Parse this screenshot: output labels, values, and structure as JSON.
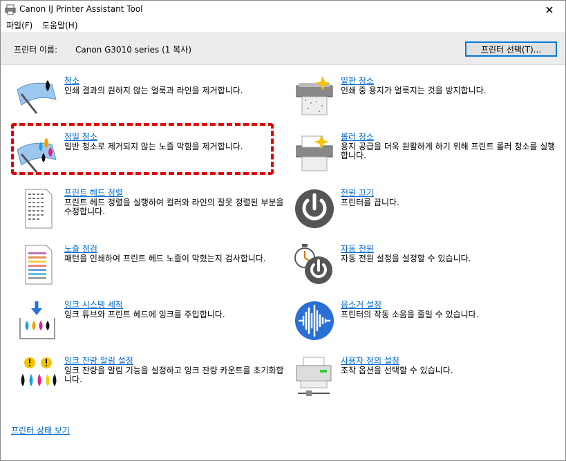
{
  "window": {
    "title": "Canon IJ Printer Assistant Tool",
    "close_label": "✕"
  },
  "menu": {
    "file": "파일(F)",
    "help": "도움말(H)"
  },
  "printer": {
    "label": "프린터 이름:",
    "name": "Canon G3010 series (1 복사)",
    "select_button": "프린터 선택(T)..."
  },
  "items": {
    "cleaning": {
      "title": "청소",
      "desc": "인쇄 결과의 원하지 않는 얼룩과 라인을 제거합니다."
    },
    "deep_cleaning": {
      "title": "정밀 청소",
      "desc": "일반 청소로 제거되지 않는 노즐 막힘을 제거합니다."
    },
    "head_alignment": {
      "title": "프린트 헤드 정렬",
      "desc": "프린트 헤드 정렬을 실행하여 컬러와 라인의 잘못 정렬된 부분을 수정합니다."
    },
    "nozzle_check": {
      "title": "노즐 점검",
      "desc": "패턴을 인쇄하여 프린트 헤드 노즐이 막혔는지 검사합니다."
    },
    "ink_flush": {
      "title": "잉크 시스템 세척",
      "desc": "잉크 튜브와 프린트 헤드에 잉크를 주입합니다."
    },
    "ink_notify": {
      "title": "잉크 잔량 알림 설정",
      "desc": "잉크 잔량을 알림 기능을 설정하고 잉크 잔량 카운트를 초기화합니다."
    },
    "bottom_plate": {
      "title": "밑판 청소",
      "desc": "인쇄 중 용지가 얼룩지는 것을 방지합니다."
    },
    "roller_cleaning": {
      "title": "롤러 청소",
      "desc": "용지 공급을 더욱 원활하게 하기 위해 프린트 롤러 청소를 실행합니다."
    },
    "power_off": {
      "title": "전원 끄기",
      "desc": "프린터를 끕니다."
    },
    "auto_power": {
      "title": "자동 전원",
      "desc": "자동 전원 설정을 설정할 수 있습니다."
    },
    "quiet": {
      "title": "음소거 설정",
      "desc": "프린터의 작동 소음을 줄일 수 있습니다."
    },
    "custom": {
      "title": "사용자 정의 설정",
      "desc": "조작 옵션을 선택할 수 있습니다."
    }
  },
  "footer": {
    "status_link": "프린터 상태 보기"
  },
  "colors": {
    "link": "#0066cc",
    "highlight": "#e00000",
    "printer_bar": "#ececec"
  }
}
